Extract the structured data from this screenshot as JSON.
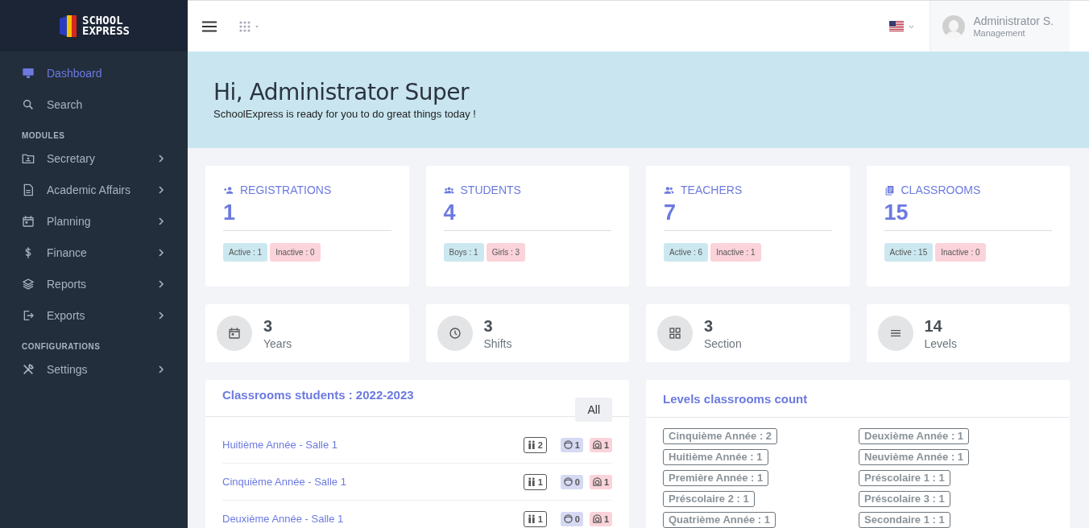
{
  "logo": {
    "line_1": "SCHOOL",
    "line_2": "EXPRESS"
  },
  "sidebar": {
    "groups": [
      {
        "items": [
          {
            "label": "Dashboard",
            "kind": "monitor",
            "selected": true,
            "has_submenu": false
          },
          {
            "label": "Search",
            "kind": "search",
            "selected": false,
            "has_submenu": false
          }
        ]
      },
      {
        "heading": "MODULES",
        "items": [
          {
            "label": "Secretary",
            "kind": "folder",
            "selected": false,
            "has_submenu": true
          },
          {
            "label": "Academic Affairs",
            "kind": "document",
            "selected": false,
            "has_submenu": true
          },
          {
            "label": "Planning",
            "kind": "calendar",
            "selected": false,
            "has_submenu": true
          },
          {
            "label": "Finance",
            "kind": "dollar",
            "selected": false,
            "has_submenu": true
          },
          {
            "label": "Reports",
            "kind": "layers",
            "selected": false,
            "has_submenu": true
          },
          {
            "label": "Exports",
            "kind": "export",
            "selected": false,
            "has_submenu": true
          }
        ]
      },
      {
        "heading": "CONFIGURATIONS",
        "items": [
          {
            "label": "Settings",
            "kind": "tools",
            "selected": false,
            "has_submenu": true
          }
        ]
      }
    ]
  },
  "header": {
    "user": {
      "name": "Administrator S.",
      "role": "Management"
    }
  },
  "banner": {
    "title": "Hi, Administrator Super",
    "subtitle": "SchoolExpress is ready for you to do great things today !"
  },
  "stat_cards": [
    {
      "title": "REGISTRATIONS",
      "kind": "person-add",
      "value": "1",
      "badges": [
        {
          "label": "Active : 1",
          "kind": "info"
        },
        {
          "label": "Inactive : 0",
          "kind": "danger"
        }
      ]
    },
    {
      "title": "STUDENTS",
      "kind": "group",
      "value": "4",
      "badges": [
        {
          "label": "Boys : 1",
          "kind": "info"
        },
        {
          "label": "Girls : 3",
          "kind": "danger"
        }
      ]
    },
    {
      "title": "TEACHERS",
      "kind": "people",
      "value": "7",
      "badges": [
        {
          "label": "Active : 6",
          "kind": "info"
        },
        {
          "label": "Inactive : 1",
          "kind": "danger"
        }
      ]
    },
    {
      "title": "CLASSROOMS",
      "kind": "copy",
      "value": "15",
      "badges": [
        {
          "label": "Active : 15",
          "kind": "info"
        },
        {
          "label": "Inactive : 0",
          "kind": "danger"
        }
      ]
    }
  ],
  "mini_stats": [
    {
      "value": "3",
      "label": "Years",
      "kind": "calendar"
    },
    {
      "value": "3",
      "label": "Shifts",
      "kind": "clock"
    },
    {
      "value": "3",
      "label": "Section",
      "kind": "grid"
    },
    {
      "value": "14",
      "label": "Levels",
      "kind": "lines"
    }
  ],
  "classrooms_panel": {
    "title": "Classrooms students : 2022-2023",
    "button": "All",
    "rows": [
      {
        "name": "Huitième Année - Salle 1",
        "total": "2",
        "boys": "1",
        "girls": "1"
      },
      {
        "name": "Cinquième Année - Salle 1",
        "total": "1",
        "boys": "0",
        "girls": "1"
      },
      {
        "name": "Deuxième Année - Salle 1",
        "total": "1",
        "boys": "0",
        "girls": "1"
      }
    ]
  },
  "levels_panel": {
    "title": "Levels classrooms count",
    "items": [
      "Cinquième Année : 2",
      "Deuxième Année : 1",
      "Huitième Année : 1",
      "Neuvième Année : 1",
      "Première Année : 1",
      "Préscolaire 1 : 1",
      "Préscolaire 2 : 1",
      "Préscolaire 3 : 1",
      "Quatrième Année : 1",
      "Secondaire 1 : 1"
    ]
  }
}
